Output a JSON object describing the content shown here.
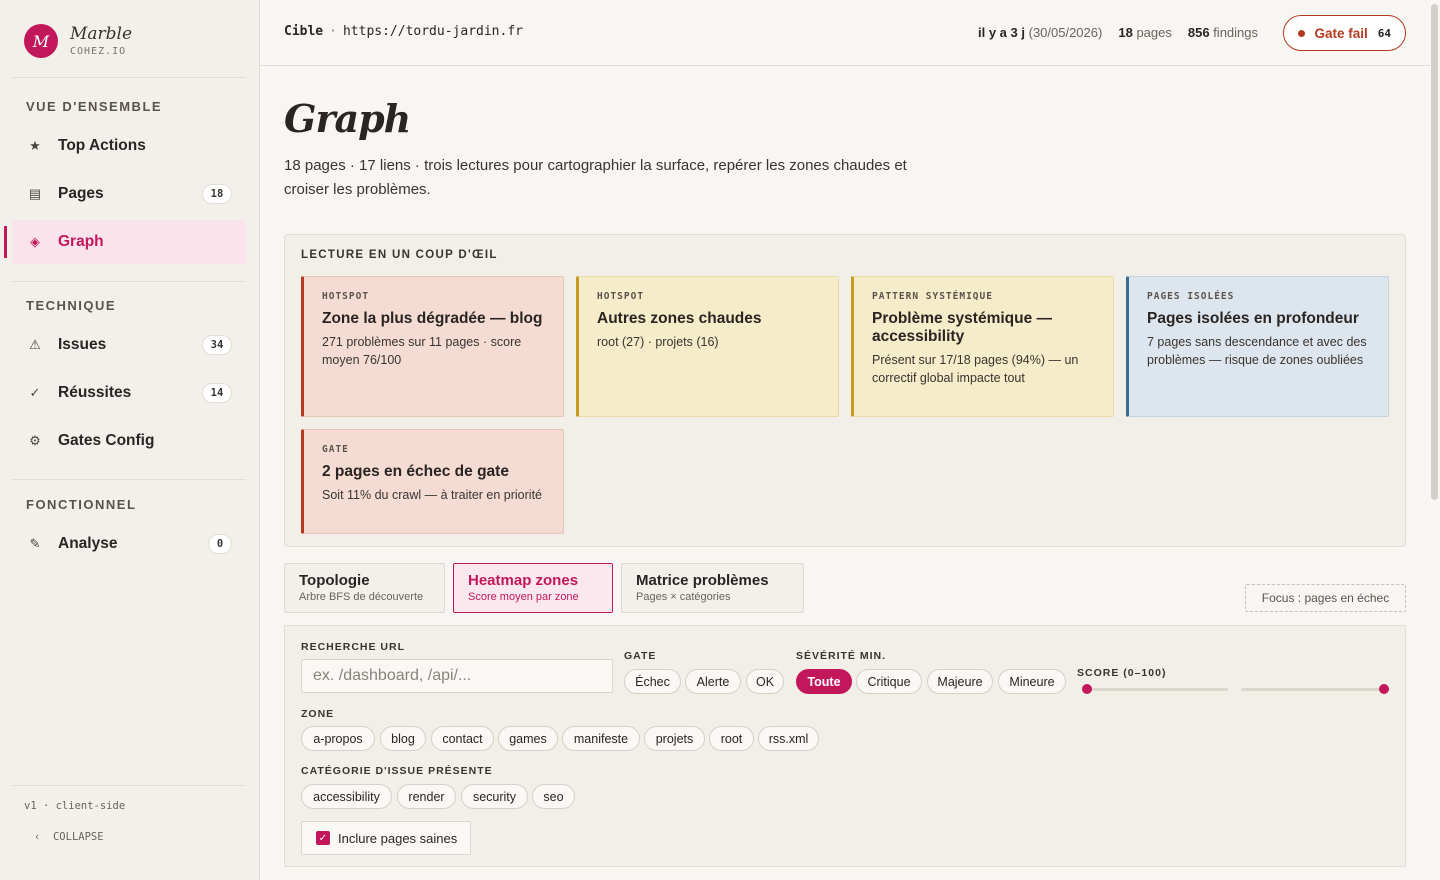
{
  "brand": {
    "logo": "M",
    "name": "Marble",
    "sub": "COHEZ.IO"
  },
  "sidebar": {
    "sections": [
      {
        "title": "VUE D'ENSEMBLE"
      },
      {
        "title": "TECHNIQUE"
      },
      {
        "title": "FONCTIONNEL"
      }
    ],
    "items": [
      {
        "icon": "★",
        "label": "Top Actions",
        "count": ""
      },
      {
        "icon": "▤",
        "label": "Pages",
        "count": "18"
      },
      {
        "icon": "◈",
        "label": "Graph",
        "count": ""
      },
      {
        "icon": "⚠",
        "label": "Issues",
        "count": "34"
      },
      {
        "icon": "✓",
        "label": "Réussites",
        "count": "14"
      },
      {
        "icon": "⚙",
        "label": "Gates Config",
        "count": ""
      },
      {
        "icon": "✎",
        "label": "Analyse",
        "count": "0"
      }
    ],
    "footer": {
      "version": "v1 · client-side",
      "collapse_icon": "‹",
      "collapse": "COLLAPSE"
    }
  },
  "topbar": {
    "target_label": "Cible",
    "separator": "·",
    "target_url": "https://tordu-jardin.fr",
    "age": "il y a 3 j",
    "date": "(30/05/2026)",
    "pages_count": "18",
    "pages_word": "pages",
    "findings_count": "856",
    "findings_word": "findings",
    "gate_label": "Gate fail",
    "gate_score": "64"
  },
  "main": {
    "title": "Graph",
    "description": "18 pages · 17 liens · trois lectures pour cartographier la surface, repérer les zones chaudes et croiser les problèmes."
  },
  "glance": {
    "title": "LECTURE EN UN COUP D'ŒIL",
    "cards": [
      {
        "tag": "HOTSPOT",
        "title": "Zone la plus dégradée — blog",
        "text": "271 problèmes sur 11 pages · score moyen 76/100",
        "tone": "#b33a1f"
      },
      {
        "tag": "HOTSPOT",
        "title": "Autres zones chaudes",
        "text": "root (27) · projets (16)",
        "tone": "#c89a24"
      },
      {
        "tag": "PATTERN SYSTÉMIQUE",
        "title": "Problème systémique — accessibility",
        "text": "Présent sur 17/18 pages (94%) — un correctif global impacte tout",
        "tone": "#c89a24"
      },
      {
        "tag": "PAGES ISOLÉES",
        "title": "Pages isolées en profondeur",
        "text": "7 pages sans descendance et avec des problèmes — risque de zones oubliées",
        "tone": "#3a6b94"
      },
      {
        "tag": "GATE",
        "title": "2 pages en échec de gate",
        "text": "Soit 11% du crawl — à traiter en priorité",
        "tone": "#b33a1f"
      }
    ]
  },
  "tabs": [
    {
      "label": "Topologie",
      "sub": "Arbre BFS de découverte"
    },
    {
      "label": "Heatmap zones",
      "sub": "Score moyen par zone"
    },
    {
      "label": "Matrice problèmes",
      "sub": "Pages × catégories"
    }
  ],
  "focus_label": "Focus : pages en échec",
  "filters": {
    "search_label": "RECHERCHE URL",
    "search_placeholder": "ex. /dashboard, /api/...",
    "gate_label": "GATE",
    "gate_options": [
      "Échec",
      "Alerte",
      "OK"
    ],
    "severity_label": "SÉVÉRITÉ MIN.",
    "severity_options": [
      "Toute",
      "Critique",
      "Majeure",
      "Mineure"
    ],
    "severity_selected": "Toute",
    "score_label": "SCORE (0–100)",
    "score_min": 0,
    "score_max": 100,
    "zone_label": "ZONE",
    "zones": [
      "a-propos",
      "blog",
      "contact",
      "games",
      "manifeste",
      "projets",
      "root",
      "rss.xml"
    ],
    "category_label": "CATÉGORIE D'ISSUE PRÉSENTE",
    "categories": [
      "accessibility",
      "render",
      "security",
      "seo"
    ],
    "healthy_label": "Inclure pages saines",
    "healthy_checked": true
  },
  "colors": {
    "accent": "#c2185b",
    "danger": "#b33a1f",
    "warning": "#c89a24",
    "info": "#3a6b94"
  }
}
